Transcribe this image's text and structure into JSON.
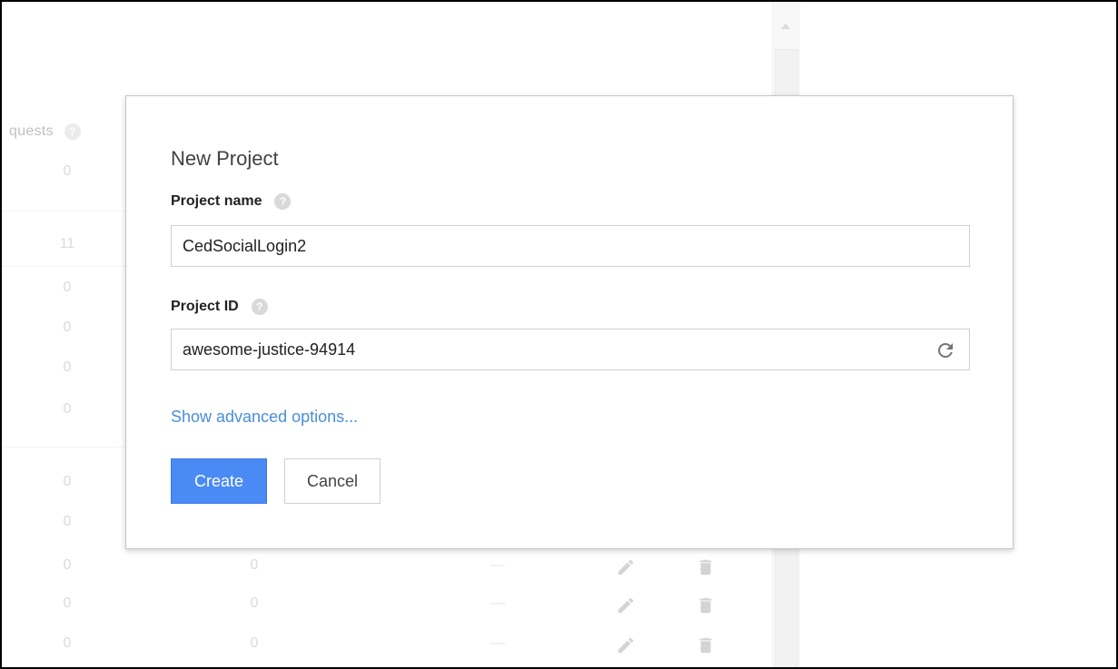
{
  "background": {
    "column_header": "quests",
    "rows": [
      {
        "requests": "0"
      },
      {
        "requests": "11"
      },
      {
        "requests": "0"
      },
      {
        "requests": "0"
      },
      {
        "requests": "0"
      },
      {
        "requests": "0"
      },
      {
        "requests": "0"
      },
      {
        "requests": "0"
      },
      {
        "requests": "0",
        "col2": "0",
        "col3": "—"
      },
      {
        "requests": "0",
        "col2": "0",
        "col3": "—"
      },
      {
        "requests": "0",
        "col2": "0",
        "col3": "—"
      }
    ]
  },
  "dialog": {
    "title": "New Project",
    "project_name_label": "Project name",
    "project_name_value": "CedSocialLogin2",
    "project_id_label": "Project ID",
    "project_id_value": "awesome-justice-94914",
    "advanced_link": "Show advanced options...",
    "create_label": "Create",
    "cancel_label": "Cancel"
  },
  "colors": {
    "primary": "#4a8af4",
    "link": "#4a8ddc",
    "muted_text": "#c8c8c8"
  },
  "icons": {
    "help": "help-icon",
    "refresh": "refresh-icon",
    "edit": "pencil-icon",
    "delete": "trash-icon"
  }
}
